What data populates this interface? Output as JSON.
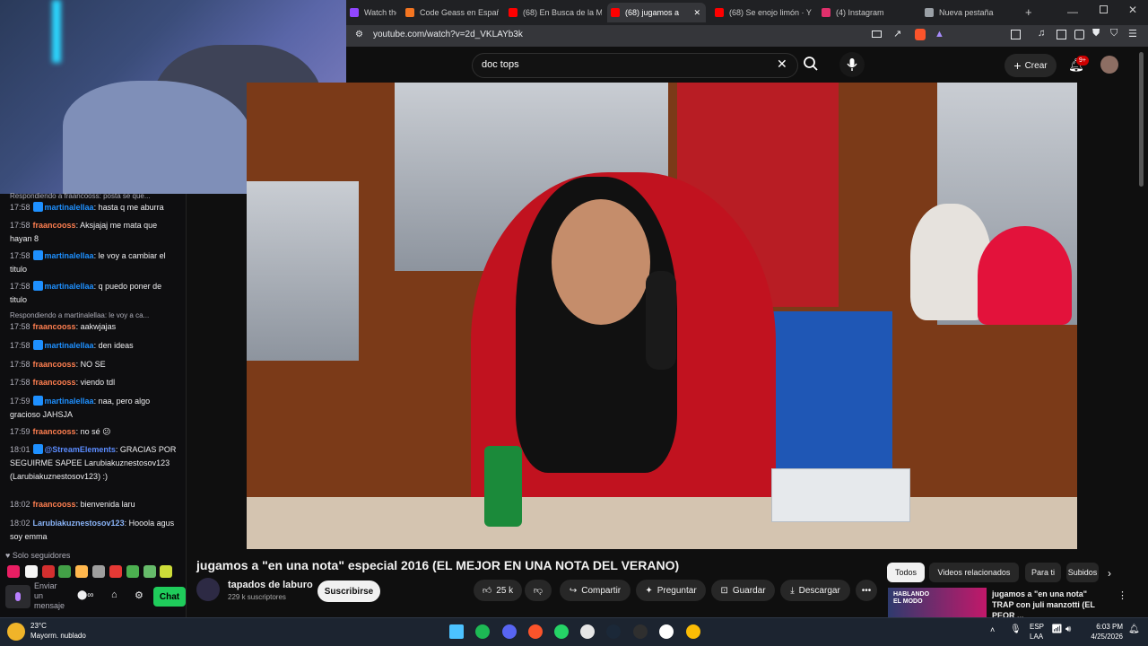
{
  "browser": {
    "tabs": [
      {
        "label": "Watch the VOD",
        "icon": "twitch-icon",
        "color": "#9146ff"
      },
      {
        "label": "Code Geass en Español",
        "icon": "crunchyroll-icon",
        "color": "#f47521"
      },
      {
        "label": "(68) En Busca de la Mejor",
        "icon": "youtube-icon",
        "color": "#ff0000"
      },
      {
        "label": "(68) jugamos a",
        "icon": "youtube-icon",
        "color": "#ff0000",
        "active": true
      },
      {
        "label": "(68) Se enojo limón · Y",
        "icon": "youtube-icon",
        "color": "#ff0000"
      },
      {
        "label": "(4) Instagram",
        "icon": "instagram-icon",
        "color": "#e1306c"
      },
      {
        "label": "Nueva pestaña",
        "icon": "new-tab-icon",
        "color": "#9aa0a6"
      }
    ],
    "url": "youtube.com/watch?v=2d_VKLAYb3k"
  },
  "youtube": {
    "search_value": "doc tops",
    "create_label": "Crear",
    "notification_count": "9+",
    "video_title": "jugamos a \"en una nota\" especial 2016 (EL MEJOR EN UNA NOTA DEL VERANO)",
    "channel_name": "tapados de laburo",
    "subscribers": "229 k suscriptores",
    "subscribe_label": "Suscribirse",
    "like_count": "25 k",
    "share_label": "Compartir",
    "ask_label": "Preguntar",
    "save_label": "Guardar",
    "download_label": "Descargar",
    "chips": [
      "Todos",
      "Videos relacionados",
      "Para ti",
      "Subidos"
    ],
    "related": {
      "title": "jugamos a \"en una nota\" TRAP con juli manzotti (EL PEOR ...",
      "thumb_text": "HABLANDO EL MODO"
    }
  },
  "chat": {
    "reply1": "Respondiendo a fraancooss: posta se que...",
    "reply2": "Respondiendo a martinalellaa: le voy a ca...",
    "messages": [
      {
        "time": "17:58",
        "user": "martinalellaa",
        "color": "#1e90ff",
        "text": "hasta q me aburra"
      },
      {
        "time": "17:58",
        "user": "fraancooss",
        "color": "#ff7f50",
        "text": "Aksjajaj me mata que hayan 8"
      },
      {
        "time": "17:58",
        "user": "martinalellaa",
        "color": "#1e90ff",
        "text": "le voy a cambiar el titulo"
      },
      {
        "time": "17:58",
        "user": "martinalellaa",
        "color": "#1e90ff",
        "text": "q puedo poner de titulo"
      },
      {
        "time": "17:58",
        "user": "fraancooss",
        "color": "#ff7f50",
        "text": "aakwjajas"
      },
      {
        "time": "17:58",
        "user": "martinalellaa",
        "color": "#1e90ff",
        "text": "den ideas"
      },
      {
        "time": "17:58",
        "user": "fraancooss",
        "color": "#ff7f50",
        "text": "NO SE"
      },
      {
        "time": "17:58",
        "user": "fraancooss",
        "color": "#ff7f50",
        "text": "viendo tdl"
      },
      {
        "time": "17:59",
        "user": "martinalellaa",
        "color": "#1e90ff",
        "text": "naa, pero algo gracioso JAHSJA"
      },
      {
        "time": "17:59",
        "user": "fraancooss",
        "color": "#ff7f50",
        "text": "no sé 😕"
      },
      {
        "time": "18:01",
        "user": "@StreamElements",
        "color": "#5b8cff",
        "text": "GRACIAS POR SEGUIRME SAPEE Larubiakuznestosov123 (Larubiakuznestosov123) :)"
      },
      {
        "time": "18:02",
        "user": "fraancooss",
        "color": "#ff7f50",
        "text": "bienvenida laru"
      },
      {
        "time": "18:02",
        "user": "Larubiakuznestosov123",
        "color": "#8ab4f8",
        "text": "Hooola agus soy emma"
      }
    ],
    "followers_only": "Solo seguidores",
    "send_placeholder": "Enviar un mensaje",
    "chat_button": "Chat"
  },
  "taskbar": {
    "weather_temp": "23°C",
    "weather_desc": "Mayorm. nublado",
    "lang_top": "ESP",
    "lang_bottom": "LAA",
    "time": "6:03 PM",
    "date": "4/25/2026"
  },
  "colors": {
    "twitch_purple": "#9146ff",
    "yt_red": "#ff0000",
    "chat_green": "#1fcc5b"
  }
}
